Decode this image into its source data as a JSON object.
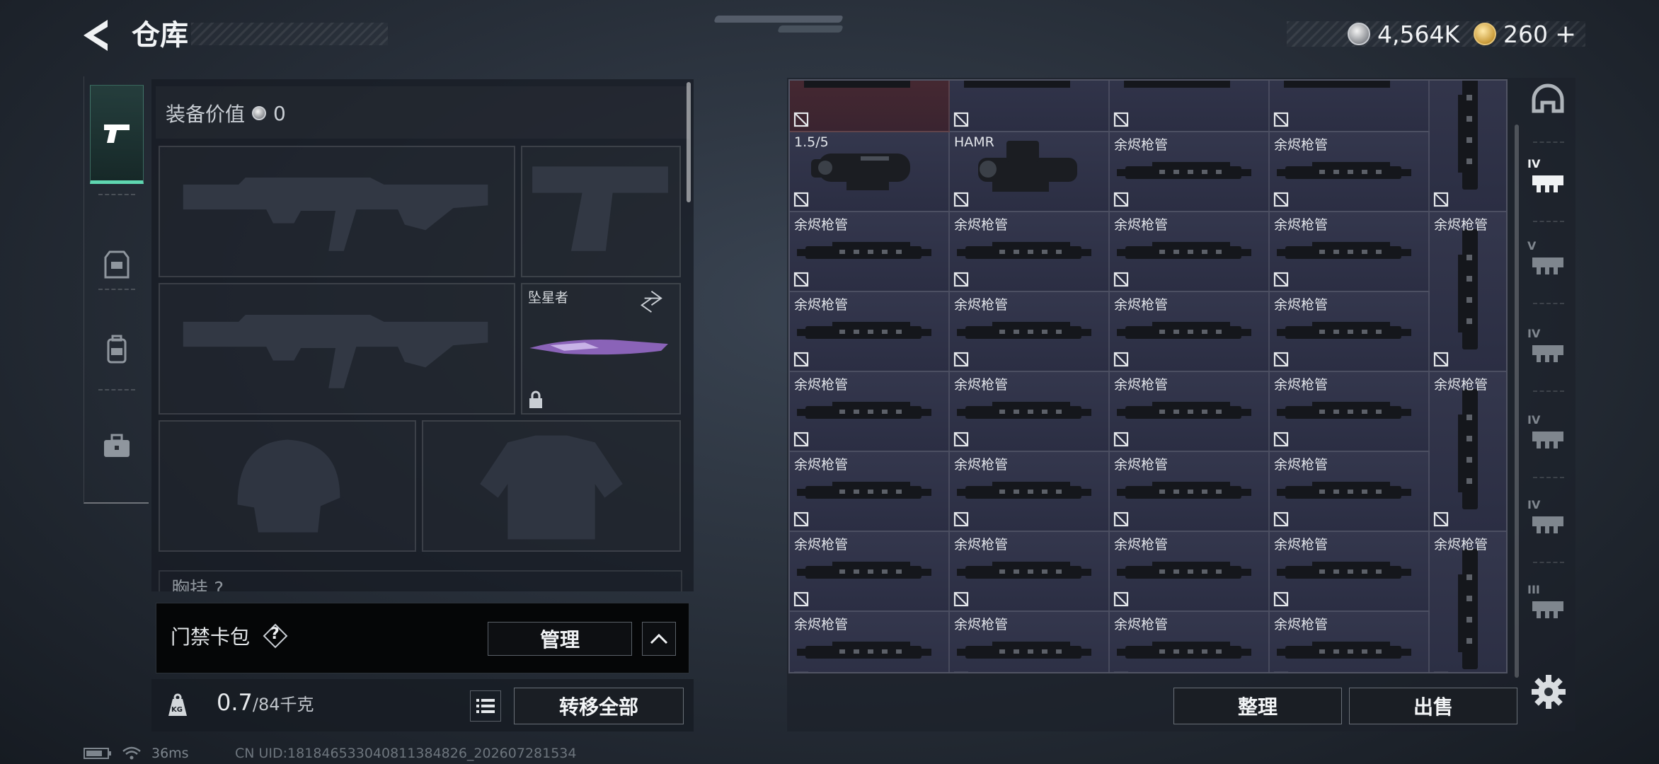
{
  "header": {
    "title": "仓库",
    "currency_silver": "4,564K",
    "currency_gold": "260",
    "currency_gold_plus": "+"
  },
  "left_tabs": [
    {
      "icon": "pistol-icon",
      "active": true
    },
    {
      "icon": "chest-rig-icon",
      "active": false
    },
    {
      "icon": "backpack-icon",
      "active": false
    },
    {
      "icon": "briefcase-icon",
      "active": false
    }
  ],
  "equipment": {
    "value_label": "装备价值",
    "value": "0",
    "melee_label": "坠星者",
    "chest_label": "胸挂",
    "chest_value": "?"
  },
  "keycard": {
    "label": "门禁卡包",
    "help": "?",
    "manage_label": "管理"
  },
  "weight": {
    "current": "0.7",
    "max": "/84千克",
    "icon_text": "KG"
  },
  "transfer_all_label": "转移全部",
  "storage": {
    "rows": [
      [
        "",
        "",
        "",
        "",
        ""
      ],
      [
        "1.5/5",
        "HAMR",
        "余烬枪管",
        "余烬枪管",
        ""
      ],
      [
        "余烬枪管",
        "余烬枪管",
        "余烬枪管",
        "余烬枪管",
        "余烬枪管"
      ],
      [
        "余烬枪管",
        "余烬枪管",
        "余烬枪管",
        "余烬枪管",
        ""
      ],
      [
        "余烬枪管",
        "余烬枪管",
        "余烬枪管",
        "余烬枪管",
        "余烬枪管"
      ],
      [
        "余烬枪管",
        "余烬枪管",
        "余烬枪管",
        "余烬枪管",
        ""
      ],
      [
        "余烬枪管",
        "余烬枪管",
        "余烬枪管",
        "余烬枪管",
        "余烬枪管"
      ],
      [
        "余烬枪管",
        "余烬枪管",
        "余烬枪管",
        "余烬枪管",
        ""
      ]
    ]
  },
  "right_tabs": [
    {
      "icon": "helmet-outline-icon",
      "tier": ""
    },
    {
      "icon": "barrel-attachment-icon",
      "tier": "IV"
    },
    {
      "icon": "scope-attachment-icon",
      "tier": "V"
    },
    {
      "icon": "grip-attachment-icon",
      "tier": "IV"
    },
    {
      "icon": "stock-attachment-icon",
      "tier": "IV"
    },
    {
      "icon": "muzzle-attachment-icon",
      "tier": "IV"
    },
    {
      "icon": "magazine-attachment-icon",
      "tier": "III"
    }
  ],
  "sort_label": "整理",
  "sell_label": "出售",
  "status": {
    "ping": "36ms",
    "uid": "CN UID:18184653304081138­4826_202607281534"
  },
  "colors": {
    "accent": "#5fd6b0",
    "grid_bg": "#2b2f42",
    "keycard_bg": "#050607"
  }
}
